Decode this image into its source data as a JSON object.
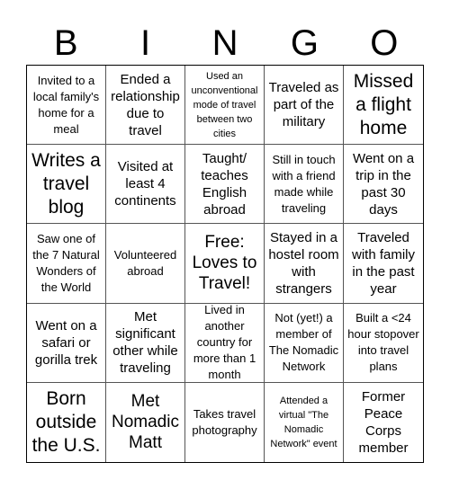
{
  "header": {
    "letters": [
      "B",
      "I",
      "N",
      "G",
      "O"
    ]
  },
  "cells": [
    {
      "text": "Invited to a local family's home for a meal",
      "size": "s2"
    },
    {
      "text": "Ended a relationship due to travel",
      "size": "s3"
    },
    {
      "text": "Used an unconventional mode of travel between two cities",
      "size": "s1"
    },
    {
      "text": "Traveled as part of the military",
      "size": "s3"
    },
    {
      "text": "Missed a flight home",
      "size": "s5"
    },
    {
      "text": "Writes a travel blog",
      "size": "s5"
    },
    {
      "text": "Visited at least 4 continents",
      "size": "s3"
    },
    {
      "text": "Taught/ teaches English abroad",
      "size": "s3"
    },
    {
      "text": "Still in touch with a friend made while traveling",
      "size": "s2"
    },
    {
      "text": "Went on a trip in the past 30 days",
      "size": "s3"
    },
    {
      "text": "Saw one of the 7 Natural Wonders of the World",
      "size": "s2"
    },
    {
      "text": "Volunteered abroad",
      "size": "s2"
    },
    {
      "text": "Free: Loves to Travel!",
      "size": "s4"
    },
    {
      "text": "Stayed in a hostel room with strangers",
      "size": "s3"
    },
    {
      "text": "Traveled with family in the past year",
      "size": "s3"
    },
    {
      "text": "Went on a safari or gorilla trek",
      "size": "s3"
    },
    {
      "text": "Met significant other while traveling",
      "size": "s3"
    },
    {
      "text": "Lived in another country for more than 1 month",
      "size": "s2"
    },
    {
      "text": "Not (yet!) a member of The Nomadic Network",
      "size": "s2"
    },
    {
      "text": "Built a <24 hour stopover into travel plans",
      "size": "s2"
    },
    {
      "text": "Born outside the U.S.",
      "size": "s5"
    },
    {
      "text": "Met Nomadic Matt",
      "size": "s4"
    },
    {
      "text": "Takes travel photography",
      "size": "s2"
    },
    {
      "text": "Attended a virtual \"The Nomadic Network\" event",
      "size": "s1"
    },
    {
      "text": "Former Peace Corps member",
      "size": "s3"
    }
  ]
}
